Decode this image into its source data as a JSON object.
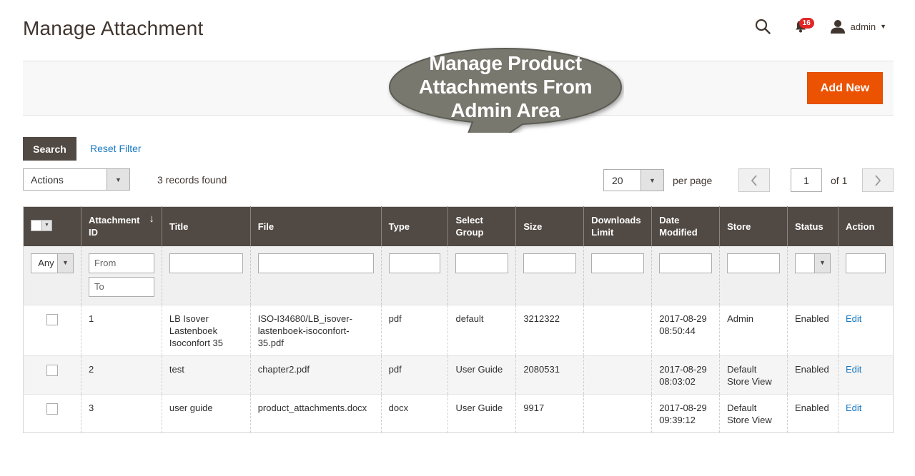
{
  "page": {
    "title": "Manage Attachment"
  },
  "header": {
    "notification_count": "16",
    "user_name": "admin"
  },
  "toolbar": {
    "add_new_label": "Add New"
  },
  "callout": {
    "line1": "Manage Product",
    "line2": "Attachments From",
    "line3": "Admin Area"
  },
  "filters": {
    "search_label": "Search",
    "reset_label": "Reset Filter"
  },
  "massaction": {
    "selected": "Actions",
    "records_found": "3 records found"
  },
  "pager": {
    "per_page_value": "20",
    "per_page_label": "per page",
    "current_page": "1",
    "of_label": "of 1"
  },
  "grid": {
    "columns": [
      "Attachment ID",
      "Title",
      "File",
      "Type",
      "Select Group",
      "Size",
      "Downloads Limit",
      "Date Modified",
      "Store",
      "Status",
      "Action"
    ],
    "filter": {
      "any_label": "Any",
      "from_placeholder": "From",
      "to_placeholder": "To"
    },
    "rows": [
      {
        "id": "1",
        "title": "LB Isover Lastenboek Isoconfort 35",
        "file": "ISO-I34680/LB_isover-lastenboek-isoconfort-35.pdf",
        "type": "pdf",
        "group": "default",
        "size": "3212322",
        "downloads_limit": "",
        "date_modified": "2017-08-29 08:50:44",
        "store": "Admin",
        "status": "Enabled",
        "action": "Edit"
      },
      {
        "id": "2",
        "title": "test",
        "file": "chapter2.pdf",
        "type": "pdf",
        "group": "User Guide",
        "size": "2080531",
        "downloads_limit": "",
        "date_modified": "2017-08-29 08:03:02",
        "store": "Default Store View",
        "status": "Enabled",
        "action": "Edit"
      },
      {
        "id": "3",
        "title": "user guide",
        "file": "product_attachments.docx",
        "type": "docx",
        "group": "User Guide",
        "size": "9917",
        "downloads_limit": "",
        "date_modified": "2017-08-29 09:39:12",
        "store": "Default Store View",
        "status": "Enabled",
        "action": "Edit"
      }
    ]
  },
  "icons": {
    "search": "search-icon",
    "bell": "bell-icon",
    "user": "user-icon",
    "caret": "caret-down-icon",
    "sort": "sort-arrow-down-icon",
    "prev": "chevron-left-icon",
    "next": "chevron-right-icon"
  },
  "colors": {
    "accent": "#eb5202",
    "grid_header": "#514943",
    "link": "#1979c3",
    "callout": "#78786e",
    "badge": "#e22626"
  }
}
